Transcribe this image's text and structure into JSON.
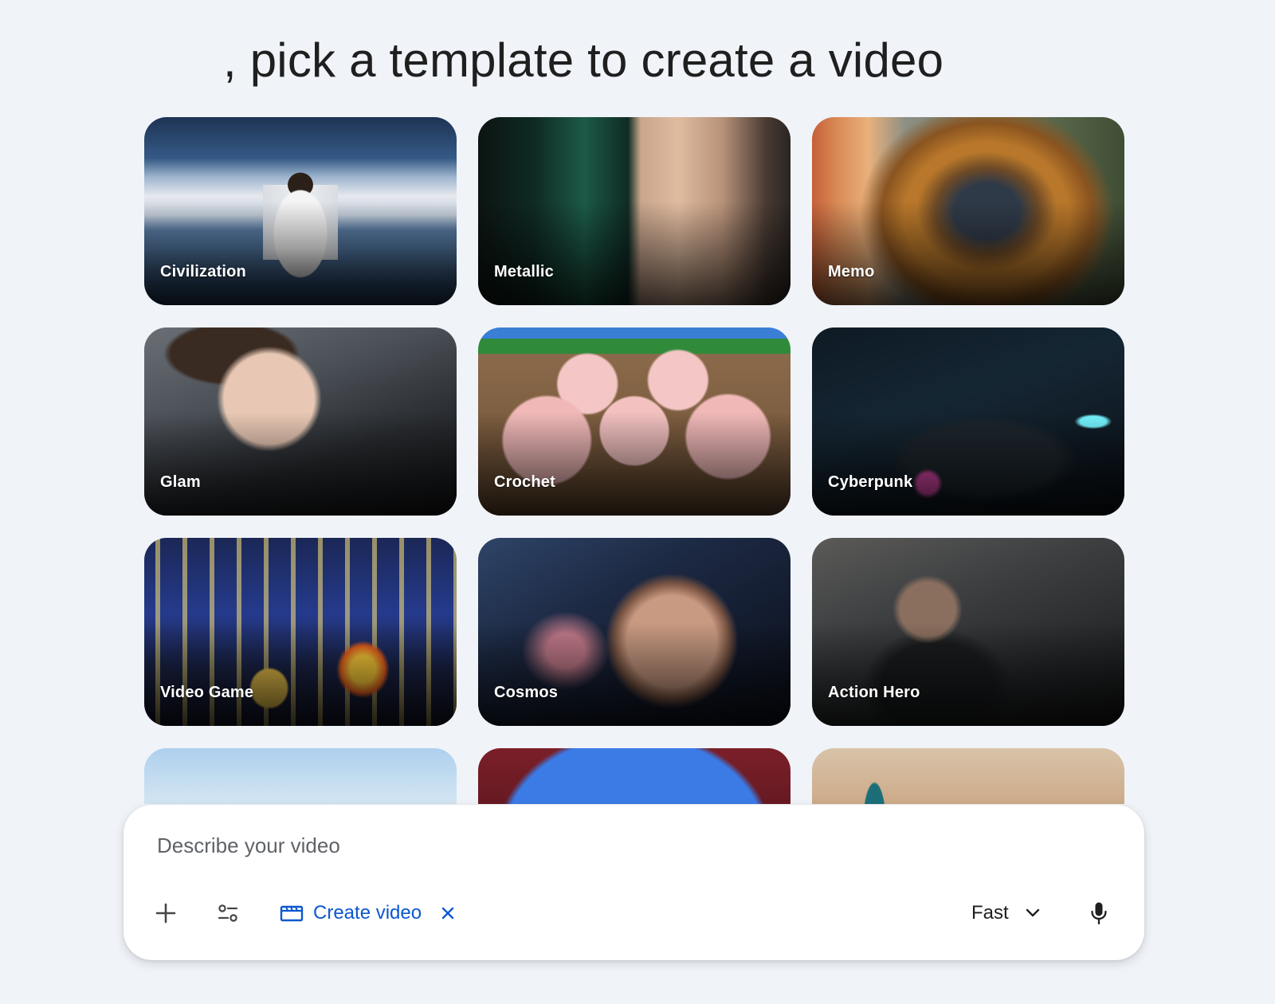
{
  "page": {
    "heading": ", pick a template to create a video"
  },
  "templates": [
    {
      "label": "Civilization",
      "thumb": "civilization"
    },
    {
      "label": "Metallic",
      "thumb": "metallic"
    },
    {
      "label": "Memo",
      "thumb": "memo"
    },
    {
      "label": "Glam",
      "thumb": "glam"
    },
    {
      "label": "Crochet",
      "thumb": "crochet"
    },
    {
      "label": "Cyberpunk",
      "thumb": "cyberpunk"
    },
    {
      "label": "Video Game",
      "thumb": "videogame"
    },
    {
      "label": "Cosmos",
      "thumb": "cosmos"
    },
    {
      "label": "Action Hero",
      "thumb": "actionhero"
    },
    {
      "label": "",
      "thumb": "nature"
    },
    {
      "label": "",
      "thumb": "cartoon"
    },
    {
      "label": "",
      "thumb": "pottery"
    }
  ],
  "composer": {
    "placeholder": "Describe your video",
    "add_icon": "plus-icon",
    "tools_icon": "tune-icon",
    "chip": {
      "icon": "clapperboard-icon",
      "label": "Create video",
      "close_icon": "close-icon"
    },
    "model": {
      "selected": "Fast",
      "icon": "chevron-down-icon"
    },
    "mic_icon": "microphone-icon"
  },
  "colors": {
    "background": "#f0f3f8",
    "accent": "#0b57d0",
    "text": "#1f1f1f",
    "placeholder": "#5f6368"
  }
}
